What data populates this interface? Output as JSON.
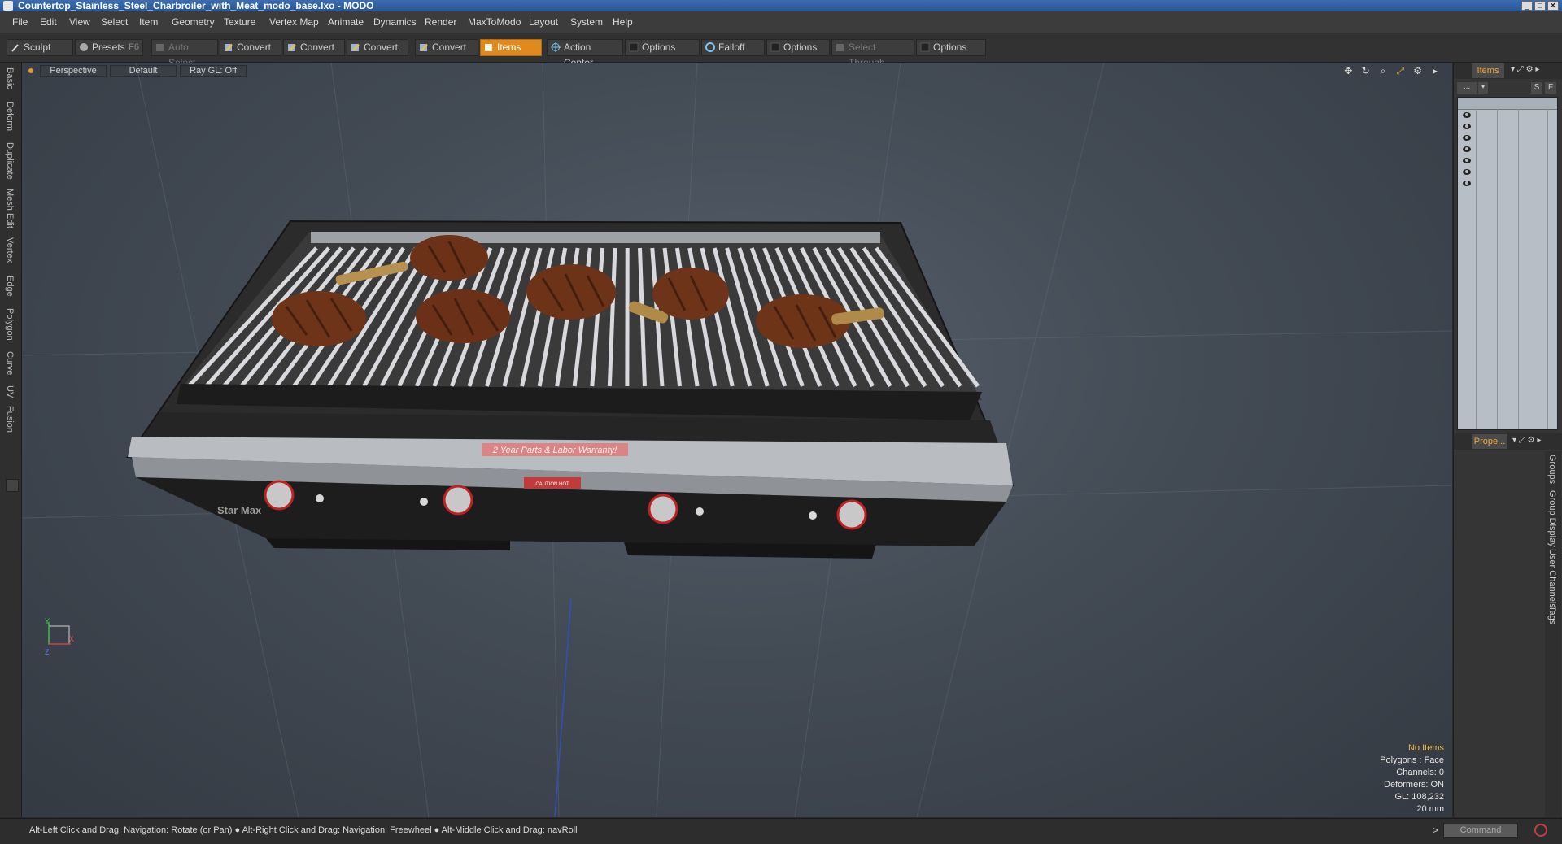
{
  "window": {
    "title": "Countertop_Stainless_Steel_Charbroiler_with_Meat_modo_base.lxo - MODO"
  },
  "menu": [
    "File",
    "Edit",
    "View",
    "Select",
    "Item",
    "Geometry",
    "Texture",
    "Vertex Map",
    "Animate",
    "Dynamics",
    "Render",
    "MaxToModo",
    "Layout",
    "System",
    "Help"
  ],
  "toolbar": {
    "sculpt": "Sculpt",
    "presets": "Presets",
    "presets_key": "F6",
    "auto_select": "Auto Select",
    "convert1": "Convert",
    "convert2": "Convert",
    "convert3": "Convert",
    "convert4": "Convert",
    "items": "Items",
    "action_center": "Action Center",
    "options1": "Options",
    "falloff": "Falloff",
    "options2": "Options",
    "select_through": "Select Through",
    "options3": "Options"
  },
  "left_tabs": [
    "Basic",
    "Deform",
    "Duplicate",
    "Mesh Edit",
    "Vertex",
    "Edge",
    "Polygon",
    "Curve",
    "UV",
    "Fusion"
  ],
  "viewport": {
    "view": "Perspective",
    "shading": "Default",
    "raygl": "Ray GL: Off",
    "banner": "2 Year Parts & Labor Warranty!",
    "caution": "CAUTION HOT",
    "brand": "Star Max",
    "axis_y": "Y",
    "axis_z": "Z",
    "axis_x": "X",
    "stats": {
      "items": "No Items",
      "polygons": "Polygons : Face",
      "channels": "Channels: 0",
      "deformers": "Deformers: ON",
      "gl": "GL: 108,232",
      "scale": "20 mm"
    }
  },
  "right_panel": {
    "items_tab": "Items",
    "props_tab": "Prope...",
    "dots": "...",
    "s_btn": "S",
    "f_btn": "F",
    "side_tabs": [
      "Groups",
      "Group Display",
      "User Channels",
      "Tags"
    ]
  },
  "status": {
    "hint": "Alt-Left Click and Drag: Navigation: Rotate (or Pan) ● Alt-Right Click and Drag: Navigation: Freewheel ● Alt-Middle Click and Drag: navRoll",
    "command_placeholder": "Command",
    "prompt": ">"
  }
}
